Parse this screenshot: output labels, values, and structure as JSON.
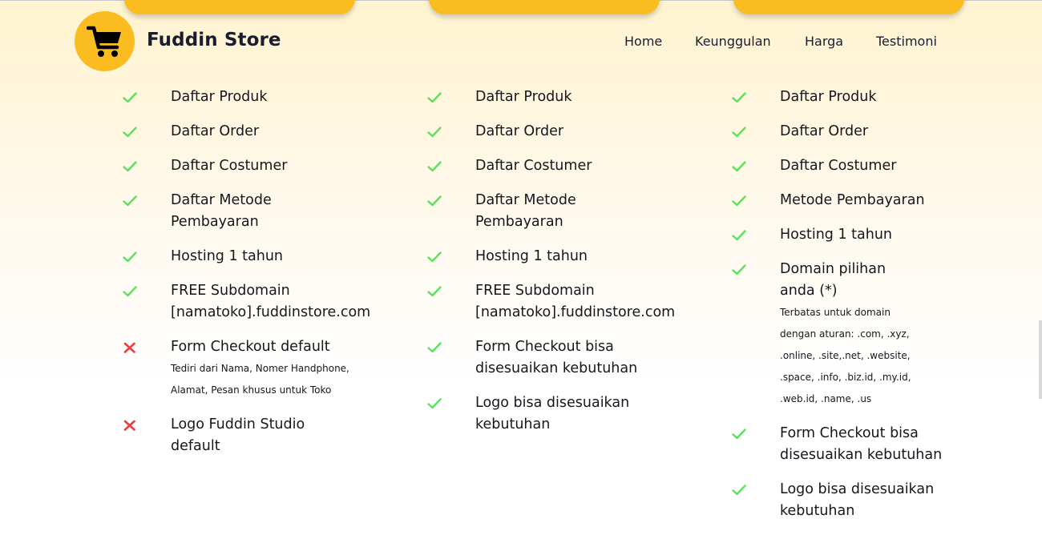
{
  "brand": {
    "name": "Fuddin Store",
    "logo_icon": "shopping-cart-icon",
    "accent_color": "#fbbc1f"
  },
  "nav": {
    "items": [
      "Home",
      "Keunggulan",
      "Harga",
      "Testimoni"
    ]
  },
  "colors": {
    "check": "#5be15b",
    "cross": "#ef3b3b"
  },
  "plans": [
    {
      "features": [
        {
          "icon": "check-icon",
          "text": "Daftar Produk"
        },
        {
          "icon": "check-icon",
          "text": "Daftar Order"
        },
        {
          "icon": "check-icon",
          "text": "Daftar Costumer"
        },
        {
          "icon": "check-icon",
          "text": "Daftar Metode Pembayaran"
        },
        {
          "icon": "check-icon",
          "text": "Hosting 1 tahun"
        },
        {
          "icon": "check-icon",
          "text": "FREE Subdomain [namatoko].fuddinstore.com"
        },
        {
          "icon": "cross-icon",
          "text": "Form Checkout default",
          "note": "Tediri dari Nama, Nomer Handphone, Alamat, Pesan khusus untuk Toko"
        },
        {
          "icon": "cross-icon",
          "text": "Logo Fuddin Studio default"
        }
      ]
    },
    {
      "features": [
        {
          "icon": "check-icon",
          "text": "Daftar Produk"
        },
        {
          "icon": "check-icon",
          "text": "Daftar Order"
        },
        {
          "icon": "check-icon",
          "text": "Daftar Costumer"
        },
        {
          "icon": "check-icon",
          "text": "Daftar Metode Pembayaran"
        },
        {
          "icon": "check-icon",
          "text": "Hosting 1 tahun"
        },
        {
          "icon": "check-icon",
          "text": "FREE Subdomain [namatoko].fuddinstore.com"
        },
        {
          "icon": "check-icon",
          "text": "Form Checkout bisa disesuaikan kebutuhan"
        },
        {
          "icon": "check-icon",
          "text": "Logo bisa disesuaikan kebutuhan"
        }
      ]
    },
    {
      "features": [
        {
          "icon": "check-icon",
          "text": "Daftar Produk"
        },
        {
          "icon": "check-icon",
          "text": "Daftar Order"
        },
        {
          "icon": "check-icon",
          "text": "Daftar Costumer"
        },
        {
          "icon": "check-icon",
          "text": "Metode Pembayaran"
        },
        {
          "icon": "check-icon",
          "text": "Hosting 1 tahun"
        },
        {
          "icon": "check-icon",
          "text": "Domain pilihan anda (*)",
          "note": "Terbatas untuk domain dengan aturan: .com, .xyz, .online, .site,.net, .website, .space, .info, .biz.id, .my.id, .web.id, .name, .us"
        },
        {
          "icon": "check-icon",
          "text": "Form Checkout bisa disesuaikan kebutuhan"
        },
        {
          "icon": "check-icon",
          "text": "Logo bisa disesuaikan kebutuhan"
        }
      ]
    }
  ]
}
